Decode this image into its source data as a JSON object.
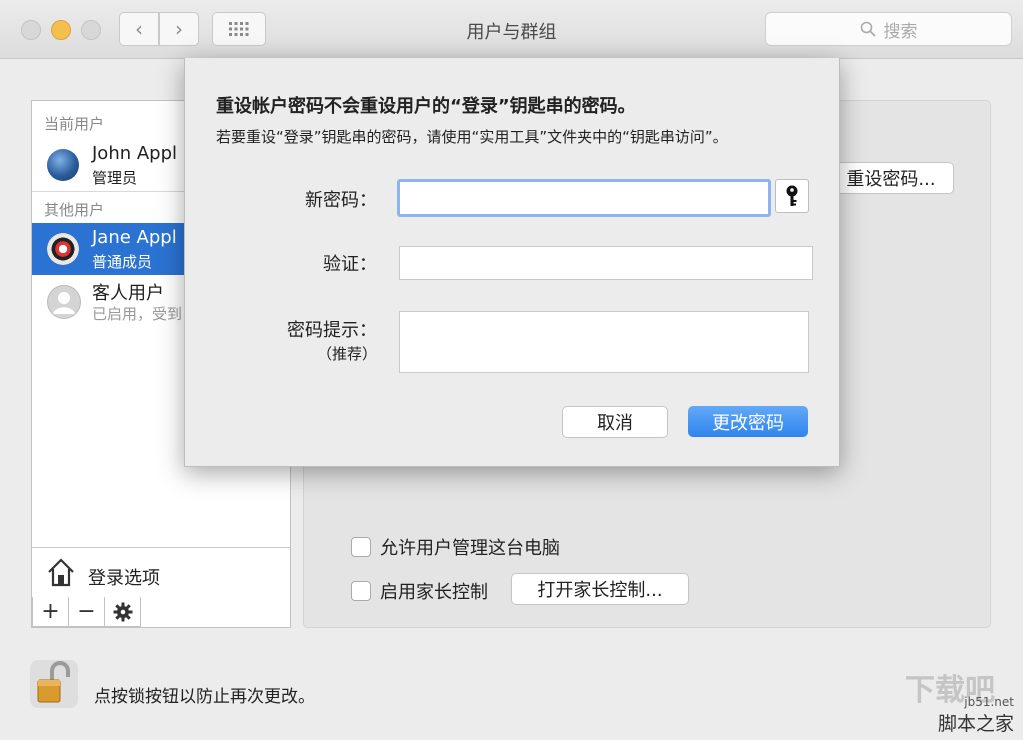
{
  "window": {
    "title": "用户与群组",
    "search_placeholder": "搜索"
  },
  "sidebar": {
    "current_header": "当前用户",
    "other_header": "其他用户",
    "users": [
      {
        "name": "John Appl",
        "role": "管理员"
      },
      {
        "name": "Jane Appl",
        "role": "普通成员"
      },
      {
        "name": "客人用户",
        "role": "已启用，受到"
      }
    ],
    "login_options": "登录选项",
    "tools": {
      "add": "+",
      "remove": "−"
    }
  },
  "main": {
    "reset_password_button": "重设密码...",
    "allow_admin_label": "允许用户管理这台电脑",
    "parental_label": "启用家长控制",
    "open_parental_button": "打开家长控制..."
  },
  "lock": {
    "text": "点按锁按钮以防止再次更改。"
  },
  "dialog": {
    "title": "重设帐户密码不会重设用户的“登录”钥匙串的密码。",
    "subtitle": "若要重设“登录”钥匙串的密码，请使用“实用工具”文件夹中的“钥匙串访问”。",
    "new_password_label": "新密码：",
    "verify_label": "验证：",
    "hint_label": "密码提示：",
    "hint_sub": "（推荐）",
    "new_password_value": "",
    "verify_value": "",
    "hint_value": "",
    "cancel_button": "取消",
    "change_button": "更改密码"
  },
  "watermark": {
    "big": "下载吧",
    "url": "jb51.net",
    "cn": "脚本之家"
  },
  "colors": {
    "selection": "#2b73d2",
    "primary_button": "#3a8ef0",
    "focus_ring": "#8db4ec",
    "minimize": "#f5bf4f"
  }
}
